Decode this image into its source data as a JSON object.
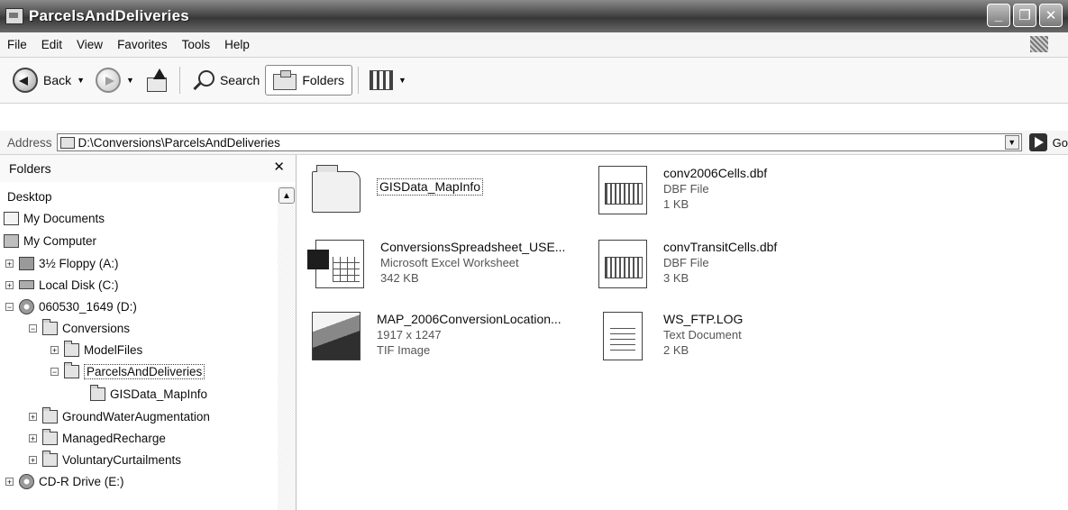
{
  "window": {
    "title": "ParcelsAndDeliveries"
  },
  "menu": [
    "File",
    "Edit",
    "View",
    "Favorites",
    "Tools",
    "Help"
  ],
  "toolbar": {
    "back_label": "Back",
    "search_label": "Search",
    "folders_label": "Folders"
  },
  "address": {
    "label": "Address",
    "path": "D:\\Conversions\\ParcelsAndDeliveries",
    "go_label": "Go"
  },
  "folders_pane": {
    "title": "Folders",
    "items": [
      {
        "label": "Desktop"
      },
      {
        "label": "My Documents"
      },
      {
        "label": "My Computer"
      },
      {
        "label": "3½ Floppy (A:)"
      },
      {
        "label": "Local Disk (C:)"
      },
      {
        "label": "060530_1649 (D:)"
      },
      {
        "label": "Conversions"
      },
      {
        "label": "ModelFiles"
      },
      {
        "label": "ParcelsAndDeliveries"
      },
      {
        "label": "GISData_MapInfo"
      },
      {
        "label": "GroundWaterAugmentation"
      },
      {
        "label": "ManagedRecharge"
      },
      {
        "label": "VoluntaryCurtailments"
      },
      {
        "label": "CD-R Drive (E:)"
      }
    ]
  },
  "files": [
    {
      "name": "GISData_MapInfo",
      "line2": "",
      "line3": "",
      "icon": "folder-icon"
    },
    {
      "name": "conv2006Cells.dbf",
      "line2": "DBF File",
      "line3": "1 KB",
      "icon": "dbf-file-icon"
    },
    {
      "name": "ConversionsSpreadsheet_USE...",
      "line2": "Microsoft Excel Worksheet",
      "line3": "342 KB",
      "icon": "excel-file-icon"
    },
    {
      "name": "convTransitCells.dbf",
      "line2": "DBF File",
      "line3": "3 KB",
      "icon": "dbf-file-icon"
    },
    {
      "name": "MAP_2006ConversionLocation...",
      "line2": "1917 x 1247",
      "line3": "TIF Image",
      "icon": "image-file-icon"
    },
    {
      "name": "WS_FTP.LOG",
      "line2": "Text Document",
      "line3": "2 KB",
      "icon": "text-file-icon"
    }
  ]
}
